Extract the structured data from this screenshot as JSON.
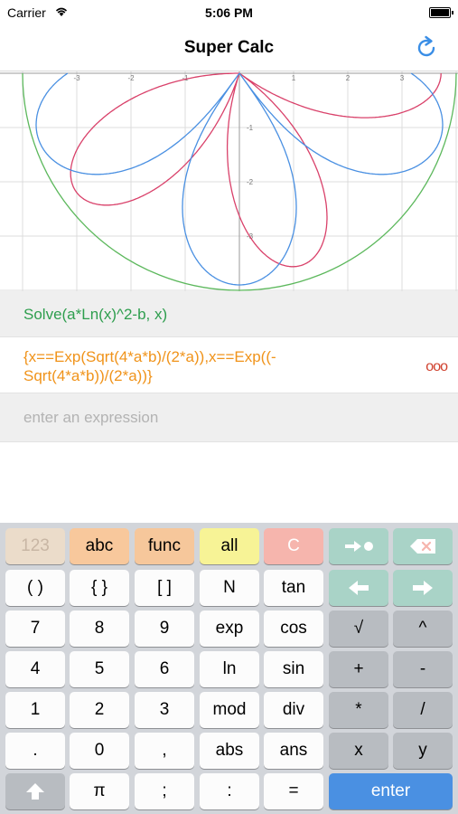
{
  "status_bar": {
    "carrier": "Carrier",
    "time": "5:06 PM",
    "battery_level": 1.0
  },
  "nav": {
    "title": "Super Calc",
    "refresh_icon": "refresh-icon"
  },
  "graph": {
    "grid_color": "#dcdcdc",
    "axis_color": "#9a9a9a",
    "x_ticks": [
      "-3",
      "-2",
      "-1",
      "1",
      "2",
      "3"
    ],
    "y_ticks": [
      "-1",
      "-2",
      "-3"
    ],
    "curve_colors": {
      "blue": "#4a90e2",
      "red": "#d9416a",
      "green": "#5cb85c"
    }
  },
  "history": {
    "input": "Solve(a*Ln(x)^2-b, x)",
    "output": "{x==Exp(Sqrt(4*a*b)/(2*a)),x==Exp((-Sqrt(4*a*b))/(2*a))}",
    "more": "ooo",
    "entry_placeholder": "enter an expression"
  },
  "keyboard": {
    "rows": [
      [
        "123",
        "abc",
        "func",
        "all",
        "C",
        "eval-icon",
        "delete-icon"
      ],
      [
        "( )",
        "{ }",
        "[ ]",
        "N",
        "tan",
        "left-arrow-icon",
        "right-arrow-icon"
      ],
      [
        "7",
        "8",
        "9",
        "exp",
        "cos",
        "√",
        "^"
      ],
      [
        "4",
        "5",
        "6",
        "ln",
        "sin",
        "+",
        "-"
      ],
      [
        "1",
        "2",
        "3",
        "mod",
        "div",
        "*",
        "/"
      ],
      [
        ".",
        "0",
        ",",
        "abs",
        "ans",
        "x",
        "y"
      ],
      [
        "shift-icon",
        "π",
        ";",
        ":",
        "=",
        "enter"
      ]
    ],
    "colors": {
      "mode": "#ebdcca",
      "abc": "#f8c89c",
      "func": "#f6c79b",
      "all": "#f7f396",
      "clear": "#f6b5ad",
      "teal": "#a9d3c7",
      "operator": "#b8bcc1",
      "enter": "#4a90e2",
      "key": "#fcfcfc"
    }
  }
}
